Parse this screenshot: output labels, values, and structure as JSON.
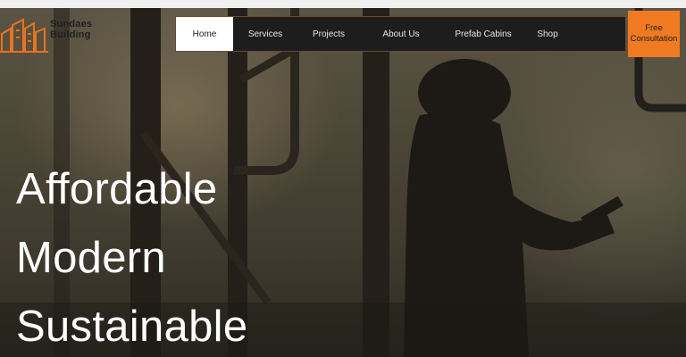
{
  "logo": {
    "icon": "building-logo-icon",
    "text": "Sundaes Building"
  },
  "nav": {
    "items": [
      {
        "label": "Home",
        "active": true
      },
      {
        "label": "Services",
        "active": false
      },
      {
        "label": "Projects",
        "active": false
      },
      {
        "label": "About Us",
        "active": false
      },
      {
        "label": "Prefab Cabins",
        "active": false
      },
      {
        "label": "Shop",
        "active": false
      }
    ],
    "cta_line1": "Free",
    "cta_line2": "Consultation"
  },
  "hero": {
    "headline_line1": "Affordable",
    "headline_line2": "Modern",
    "headline_line3": "Sustainable"
  },
  "colors": {
    "accent": "#f07a21",
    "nav_background": "#1d1d1d",
    "active_tab": "#ffffff"
  }
}
